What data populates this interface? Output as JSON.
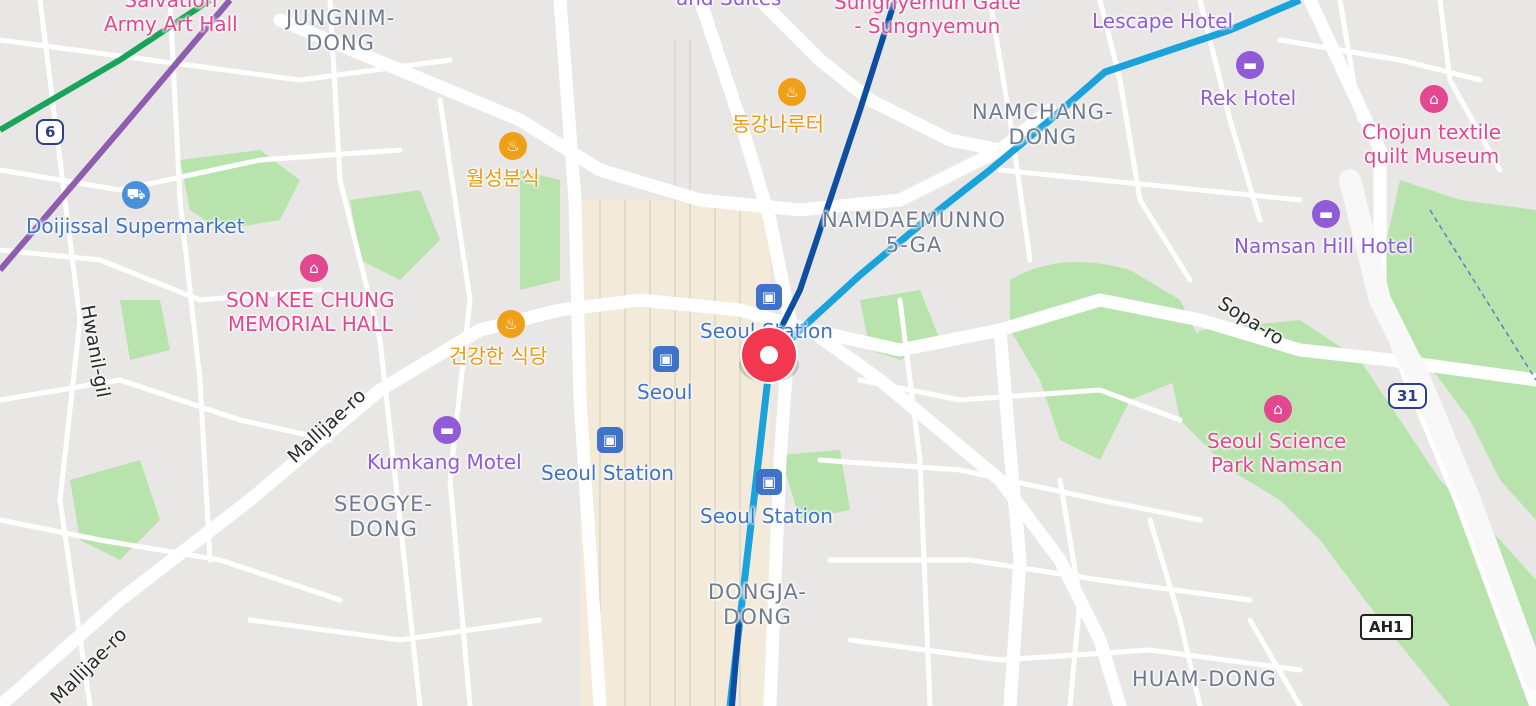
{
  "map": {
    "districts": {
      "jungnim": "JUNGNIM-\nDONG",
      "namchang": "NAMCHANG-\nDONG",
      "namdaemunno": "NAMDAEMUNNO\n5-GA",
      "seogye": "SEOGYE-\nDONG",
      "dongja": "DONGJA-\nDONG",
      "huam": "HUAM-DONG"
    },
    "pois": {
      "army_hall": "Salvation\nArmy Art Hall",
      "sungnyemun": "Sungnyemun Gate\n- Sungnyemun",
      "lescape": "Lescape Hotel",
      "suites": "and Suites",
      "rek": "Rek Hotel",
      "chojun": "Chojun textile\nquilt Museum",
      "namsan_hill": "Namsan Hill Hotel",
      "science_park": "Seoul Science\nPark Namsan",
      "son_kee_chung": "SON KEE CHUNG\nMEMORIAL HALL",
      "supermarket": "Doijissal Supermarket",
      "kumkang": "Kumkang Motel",
      "dongang": "동강나루터",
      "wolseong": "월성분식",
      "geongang": "건강한 식당",
      "seoul": "Seoul",
      "seoul_station_1": "Seoul Station",
      "seoul_station_2": "Seoul Station",
      "seoul_station_3": "Seoul Station"
    },
    "roads": {
      "hwanil": "Hwanil-gil",
      "mallijae_1": "Mallijae-ro",
      "mallijae_2": "Mallijae-ro",
      "sopa": "Sopa-ro"
    },
    "shields": {
      "route_6": "6",
      "route_31": "31",
      "ah1": "AH1"
    },
    "icons": {
      "restaurant": "restaurant-icon",
      "hotel": "hotel-icon",
      "museum": "museum-icon",
      "shop": "shopping-cart-icon",
      "train": "train-station-icon",
      "pin": "location-pin-icon"
    },
    "colors": {
      "line_green": "#1aa35a",
      "line_purple": "#8e5db0",
      "line_navy": "#0b4ea2",
      "line_skyblue": "#1aa2dc",
      "pin_red": "#f2384f",
      "park_green": "#a9dca0"
    }
  }
}
